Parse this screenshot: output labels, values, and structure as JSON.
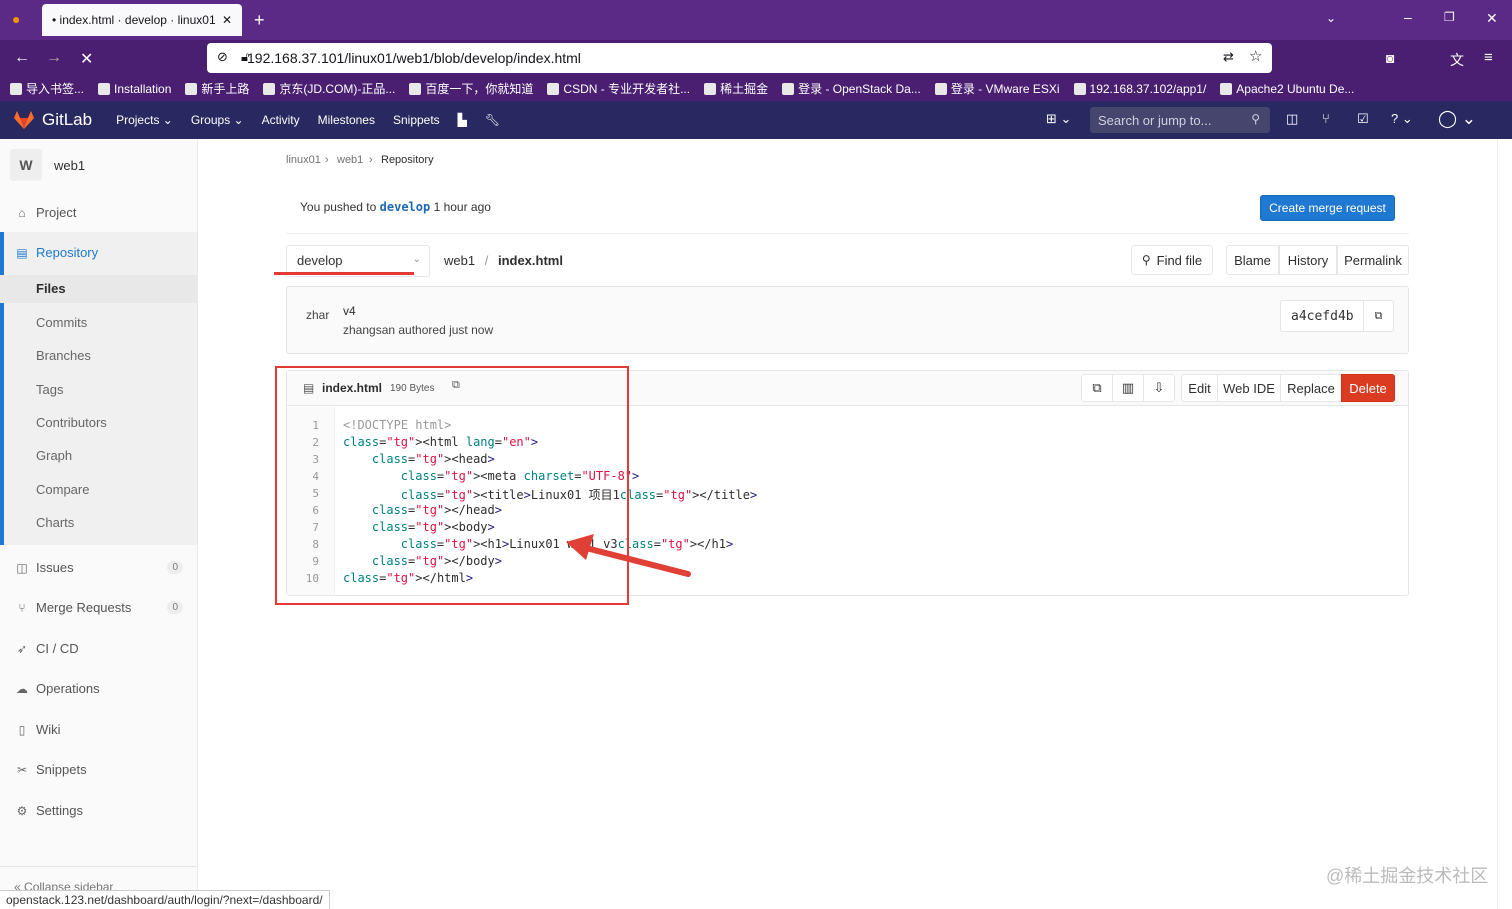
{
  "browser": {
    "tab_title": "• index.html · develop · linux01",
    "url": "192.168.37.101/linux01/web1/blob/develop/index.html",
    "bookmarks": [
      {
        "label": "导入书签...",
        "icon": "import-icon"
      },
      {
        "label": "Installation",
        "icon": "z-icon"
      },
      {
        "label": "新手上路",
        "icon": "firefox-icon"
      },
      {
        "label": "京东(JD.COM)-正品...",
        "icon": "jd-icon"
      },
      {
        "label": "百度一下，你就知道",
        "icon": "baidu-icon"
      },
      {
        "label": "CSDN - 专业开发者社...",
        "icon": "csdn-icon"
      },
      {
        "label": "稀土掘金",
        "icon": "juejin-icon"
      },
      {
        "label": "登录 - OpenStack Da...",
        "icon": "openstack-icon"
      },
      {
        "label": "登录 - VMware ESXi",
        "icon": "vmware-icon"
      },
      {
        "label": "192.168.37.102/app1/",
        "icon": "globe-icon"
      },
      {
        "label": "Apache2 Ubuntu De...",
        "icon": "ubuntu-icon"
      }
    ],
    "status_url": "openstack.123.net/dashboard/auth/login/?next=/dashboard/"
  },
  "gitlab_header": {
    "brand": "GitLab",
    "nav": [
      "Projects ⌄",
      "Groups ⌄",
      "Activity",
      "Milestones",
      "Snippets"
    ],
    "search_placeholder": "Search or jump to..."
  },
  "sidebar": {
    "project_initial": "W",
    "project_name": "web1",
    "project_label": "Project",
    "repository_label": "Repository",
    "repo_subitems": [
      "Files",
      "Commits",
      "Branches",
      "Tags",
      "Contributors",
      "Graph",
      "Compare",
      "Charts"
    ],
    "issues_label": "Issues",
    "issues_count": "0",
    "mr_label": "Merge Requests",
    "mr_count": "0",
    "cicd_label": "CI / CD",
    "operations_label": "Operations",
    "wiki_label": "Wiki",
    "snippets_label": "Snippets",
    "settings_label": "Settings",
    "collapse_label": "Collapse sidebar"
  },
  "breadcrumb": [
    "linux01",
    "web1",
    "Repository"
  ],
  "alert": {
    "prefix": "You pushed to",
    "branch": "develop",
    "suffix": "1 hour ago",
    "button": "Create merge request"
  },
  "file_nav": {
    "branch": "develop",
    "path_root": "web1",
    "path_sep": "/",
    "file_name": "index.html",
    "find_file": "Find file",
    "blame": "Blame",
    "history": "History",
    "permalink": "Permalink"
  },
  "commit": {
    "avatar_text": "zhar",
    "title": "v4",
    "meta": "zhangsan authored just now",
    "sha": "a4cefd4b"
  },
  "file": {
    "name": "index.html",
    "size": "190 Bytes",
    "edit": "Edit",
    "web_ide": "Web IDE",
    "replace": "Replace",
    "delete": "Delete"
  },
  "code_lines": [
    "<!DOCTYPE html>",
    "<html lang=\"en\">",
    "    <head>",
    "        <meta charset=\"UTF-8\">",
    "        <title>Linux01 项目1</title>",
    "    </head>",
    "    <body>",
    "        <h1>Linux01 web1 v3</h1>",
    "    </body>",
    "</html>"
  ],
  "watermark": "@稀土掘金技术社区",
  "colors": {
    "gitlab_header": "#292961",
    "primary_blue": "#1f78d1",
    "danger_red": "#db3b21",
    "annotation_red": "#e53935",
    "browser_purple": "#5b2a86"
  }
}
